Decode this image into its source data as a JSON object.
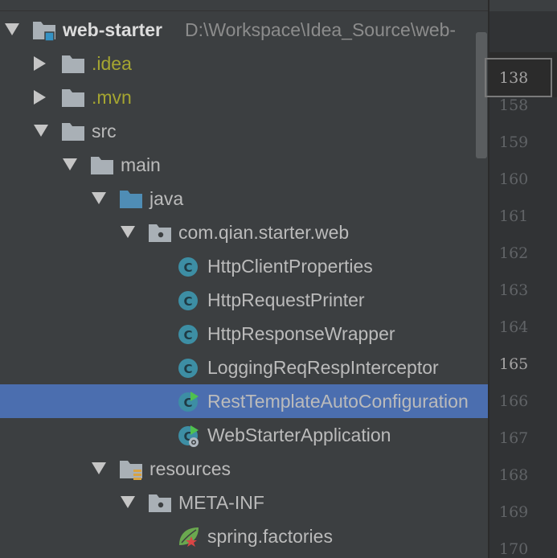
{
  "tree": [
    {
      "label": "web-starter",
      "path": "D:\\Workspace\\Idea_Source\\web-",
      "depth": 0,
      "arrow": "down",
      "icon": "module-folder",
      "style": "bold"
    },
    {
      "label": ".idea",
      "depth": 1,
      "arrow": "right",
      "icon": "folder",
      "style": "yellow"
    },
    {
      "label": ".mvn",
      "depth": 1,
      "arrow": "right",
      "icon": "folder",
      "style": "yellow"
    },
    {
      "label": "src",
      "depth": 1,
      "arrow": "down",
      "icon": "folder"
    },
    {
      "label": "main",
      "depth": 2,
      "arrow": "down",
      "icon": "folder"
    },
    {
      "label": "java",
      "depth": 3,
      "arrow": "down",
      "icon": "source-folder"
    },
    {
      "label": "com.qian.starter.web",
      "depth": 4,
      "arrow": "down",
      "icon": "package"
    },
    {
      "label": "HttpClientProperties",
      "depth": 5,
      "icon": "class"
    },
    {
      "label": "HttpRequestPrinter",
      "depth": 5,
      "icon": "class"
    },
    {
      "label": "HttpResponseWrapper",
      "depth": 5,
      "icon": "class"
    },
    {
      "label": "LoggingReqRespInterceptor",
      "depth": 5,
      "icon": "class"
    },
    {
      "label": "RestTemplateAutoConfiguration",
      "depth": 5,
      "icon": "config-class",
      "selected": true
    },
    {
      "label": "WebStarterApplication",
      "depth": 5,
      "icon": "spring-boot-class"
    },
    {
      "label": "resources",
      "depth": 3,
      "arrow": "down",
      "icon": "resources-folder"
    },
    {
      "label": "META-INF",
      "depth": 4,
      "arrow": "down",
      "icon": "package"
    },
    {
      "label": "spring.factories",
      "depth": 5,
      "icon": "spring-file"
    }
  ],
  "gutter": {
    "current_box_line": "138",
    "line_numbers": [
      "158",
      "159",
      "160",
      "161",
      "162",
      "163",
      "164",
      "165",
      "166",
      "167",
      "168",
      "169",
      "170"
    ],
    "highlighted_line": "165"
  },
  "colors": {
    "panel_bg": "#3c3f41",
    "selection": "#4b6eaf",
    "text": "#bbbbbb",
    "excluded_text": "#a5a531",
    "path_text": "#8c8c8c",
    "class_icon": "#3d8ea4"
  }
}
